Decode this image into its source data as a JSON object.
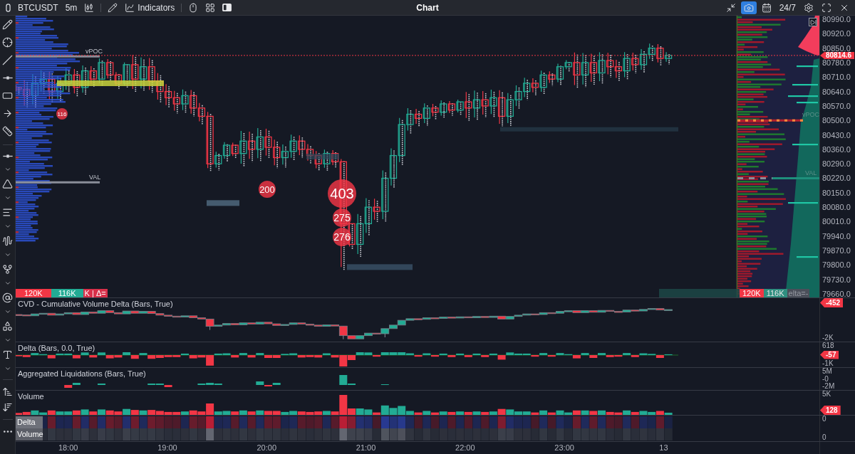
{
  "top_bar": {
    "symbol": "BTCUSDT",
    "timeframe": "5m",
    "indicators": "Indicators",
    "title": "Chart",
    "camera_active": true,
    "session": "24/7"
  },
  "price_pane": {
    "left_profile": {
      "poc_label": "vPOC",
      "val_label": "VAL"
    },
    "right_profile": {
      "poc_label": "vPOC",
      "val_label": "VAL"
    },
    "bubbles": [
      "116",
      "200",
      "403",
      "275",
      "276"
    ],
    "footer_left": [
      {
        "kind": "sell",
        "text": "120K"
      },
      {
        "kind": "buy",
        "text": "116K"
      },
      {
        "kind": "delta",
        "text": "K | Δ="
      }
    ],
    "footer_right": [
      {
        "kind": "sell",
        "text": "120K"
      },
      {
        "kind": "buy",
        "text": "116K"
      },
      {
        "kind": "delta",
        "text": "elta=-"
      }
    ]
  },
  "price_axis": {
    "labels": [
      "80990.0",
      "80920.0",
      "80850.0",
      "80780.0",
      "80710.0",
      "80640.0",
      "80570.0",
      "80500.0",
      "80430.0",
      "80360.0",
      "80290.0",
      "80220.0",
      "80150.0",
      "80080.0",
      "80010.0",
      "79940.0",
      "79870.0",
      "79800.0",
      "79730.0",
      "79660.0"
    ],
    "current_price": "80814.6"
  },
  "panes": [
    {
      "kind": "cvd",
      "title": "CVD - Cumulative Volume Delta (Bars, True)",
      "axis_labels": [
        "-2K"
      ],
      "last_value": "-452"
    },
    {
      "kind": "delta",
      "title": "Delta (Bars, 0.0, True)",
      "axis_labels": [
        "618",
        "-1K"
      ],
      "last_value": "-57"
    },
    {
      "kind": "liquidations",
      "title": "Aggregated Liquidations (Bars, True)",
      "axis_labels": [
        "5M",
        "-0",
        "-2M"
      ]
    },
    {
      "kind": "volume",
      "title": "Volume",
      "axis_labels": [
        "5K"
      ],
      "last_value": "128"
    }
  ],
  "heatmap": {
    "rows": [
      "Delta",
      "Volume"
    ],
    "axis_labels": [
      "0",
      "0"
    ]
  },
  "time_axis": [
    "18:00",
    "19:00",
    "20:00",
    "21:00",
    "22:00",
    "23:00",
    "13"
  ]
}
